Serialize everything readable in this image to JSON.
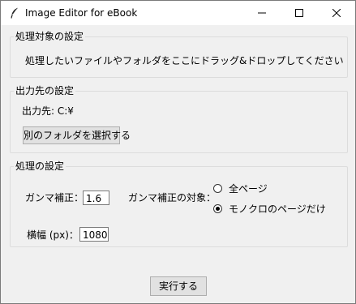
{
  "window": {
    "title": "Image Editor for eBook",
    "icon": "feather-icon",
    "controls": [
      "minimize-icon",
      "maximize-icon",
      "close-icon"
    ]
  },
  "target_group": {
    "legend": "処理対象の設定",
    "drop_hint": "処理したいファイルやフォルダをここにドラッグ&ドロップしてください"
  },
  "output_group": {
    "legend": "出力先の設定",
    "output_path": "出力先: C:¥",
    "choose_folder_label": "別のフォルダを選択する"
  },
  "processing_group": {
    "legend": "処理の設定",
    "gamma_label": "ガンマ補正：",
    "gamma_value": "1.6",
    "gamma_target_label": "ガンマ補正の対象：",
    "options": [
      {
        "label": "全ページ",
        "selected": false
      },
      {
        "label": "モノクロのページだけ",
        "selected": true
      }
    ],
    "width_label": "横幅 (px)：",
    "width_value": "1080"
  },
  "run_label": "実行する"
}
